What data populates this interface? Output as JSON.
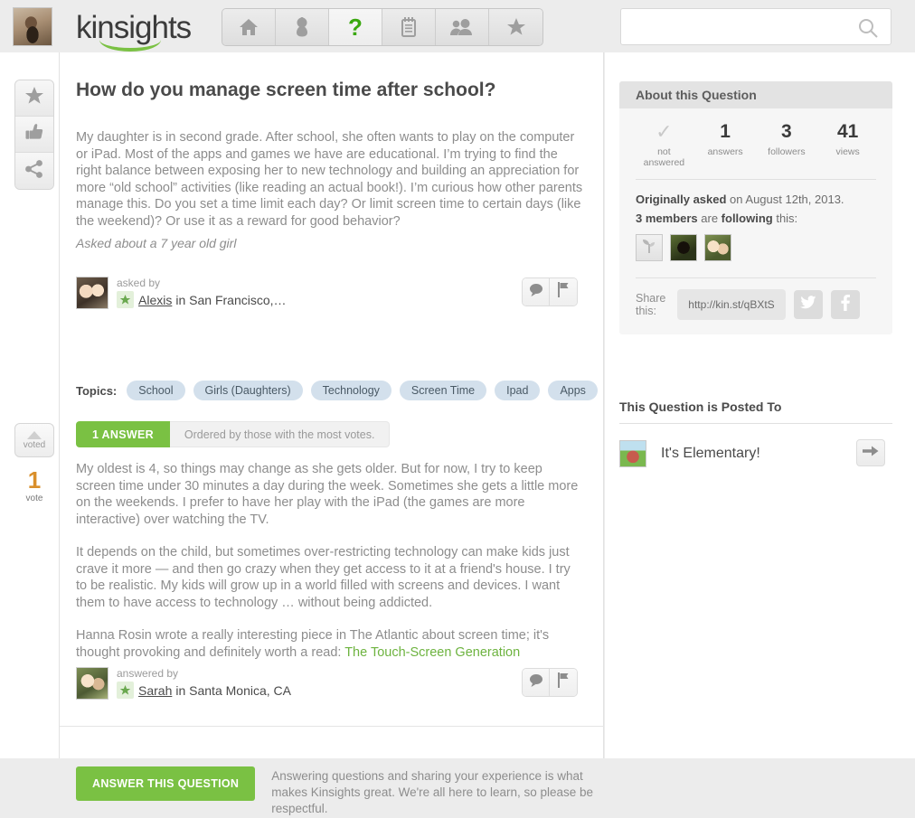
{
  "header": {
    "logo_text": "kinsights",
    "avatar_name": "user-avatar",
    "nav": [
      {
        "id": "home",
        "icon": "home-icon",
        "active": false
      },
      {
        "id": "baby",
        "icon": "baby-icon",
        "active": false
      },
      {
        "id": "questions",
        "icon": "question-mark-icon",
        "label": "?",
        "active": true
      },
      {
        "id": "journal",
        "icon": "notepad-icon",
        "active": false
      },
      {
        "id": "people",
        "icon": "people-icon",
        "active": false
      },
      {
        "id": "favorites",
        "icon": "star-icon",
        "active": false
      }
    ],
    "search": {
      "value": "",
      "placeholder": "",
      "icon": "search-icon"
    }
  },
  "left_rail": {
    "buttons": [
      {
        "id": "favorite",
        "icon": "star-icon"
      },
      {
        "id": "like",
        "icon": "thumbs-up-icon"
      },
      {
        "id": "share",
        "icon": "share-icon"
      }
    ],
    "vote": {
      "button_label": "voted",
      "count": "1",
      "count_label": "vote",
      "count_color": "#d98f2b"
    }
  },
  "question": {
    "title": "How do you manage screen time after school?",
    "body": "My daughter is in second grade. After school, she often wants to play on the computer or iPad. Most of the apps and games we have are educational. I’m trying to find the right balance between exposing her to new technology and building an appreciation for more “old school” activities (like reading an actual book!). I’m curious how other parents manage this. Do you set a time limit each day? Or limit screen time to certain days (like the weekend)? Or use it as a reward for good behavior?",
    "about": "Asked about a 7 year old girl",
    "byline": {
      "label": "asked by",
      "name": "Alexis",
      "location": "in San Francisco,…"
    },
    "actions": {
      "comment": "comment-icon",
      "flag": "flag-icon"
    },
    "topics_label": "Topics:",
    "topics": [
      "School",
      "Girls (Daughters)",
      "Technology",
      "Screen Time",
      "Ipad",
      "Apps"
    ]
  },
  "answers": {
    "tab_label": "1 ANSWER",
    "order_label": "Ordered by those with the most votes.",
    "paragraphs": [
      "My oldest is 4, so things may change as she gets older. But for now, I try to keep screen time under 30 minutes a day during the week. Sometimes she gets a little more on the weekends. I prefer to have her play with the iPad (the games are more interactive) over watching the TV.",
      "It depends on the child, but sometimes over-restricting technology can make kids just crave it more — and then go crazy when they get access to it at a friend's house. I try to be realistic. My kids will grow up in a world filled with screens and devices.  I want them to have access to technology … without being addicted."
    ],
    "link_paragraph_prefix": "Hanna Rosin wrote a really interesting piece in The Atlantic about screen time; it's thought provoking and definitely worth a read: ",
    "link_text": "The Touch-Screen Generation",
    "byline": {
      "label": "answered by",
      "name": "Sarah",
      "location": "in Santa Monica, CA"
    }
  },
  "cta": {
    "button_label": "ANSWER THIS QUESTION",
    "text": "Answering questions and sharing your experience is what makes Kinsights great. We're all here to learn, so please be respectful."
  },
  "about_panel": {
    "title": "About this Question",
    "stats": [
      {
        "value": "✓",
        "label": "not answered",
        "is_check": true
      },
      {
        "value": "1",
        "label": "answers",
        "is_check": false
      },
      {
        "value": "3",
        "label": "followers",
        "is_check": false
      },
      {
        "value": "41",
        "label": "views",
        "is_check": false
      }
    ],
    "asked_bold": "Originally asked",
    "asked_rest": " on August 12th, 2013.",
    "members_count": "3 members",
    "members_mid": " are ",
    "members_bold2": "following",
    "members_end": " this:",
    "share_label": "Share this:",
    "share_url": "http://kin.st/qBXtS",
    "twitter_icon": "twitter-icon",
    "facebook_icon": "facebook-icon"
  },
  "posted_to": {
    "title": "This Question is Posted To",
    "group_name": "It's Elementary!",
    "go_icon": "arrow-right-icon"
  },
  "colors": {
    "brand_green": "#7ac143",
    "link_green": "#6db33f",
    "vote_orange": "#d98f2b",
    "topic_pill": "#d3e0ec",
    "page_bg": "#ececec"
  }
}
